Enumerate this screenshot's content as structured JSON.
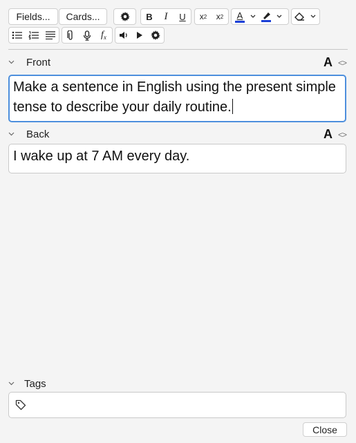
{
  "toolbar": {
    "fields_label": "Fields...",
    "cards_label": "Cards...",
    "bold": "B",
    "italic": "I",
    "underline": "U",
    "text_color": "#1a3fd6",
    "highlight_color": "#1a3fd6"
  },
  "fields": [
    {
      "name": "Front",
      "content": "Make a sentence in English using the present simple tense to describe your daily routine.",
      "font_toggle": "A"
    },
    {
      "name": "Back",
      "content": "I wake up at 7 AM every day.",
      "font_toggle": "A"
    }
  ],
  "tags": {
    "label": "Tags",
    "value": ""
  },
  "footer": {
    "close_label": "Close"
  },
  "colors": {
    "focus": "#4d8fdd",
    "background": "#f4f4f4"
  }
}
